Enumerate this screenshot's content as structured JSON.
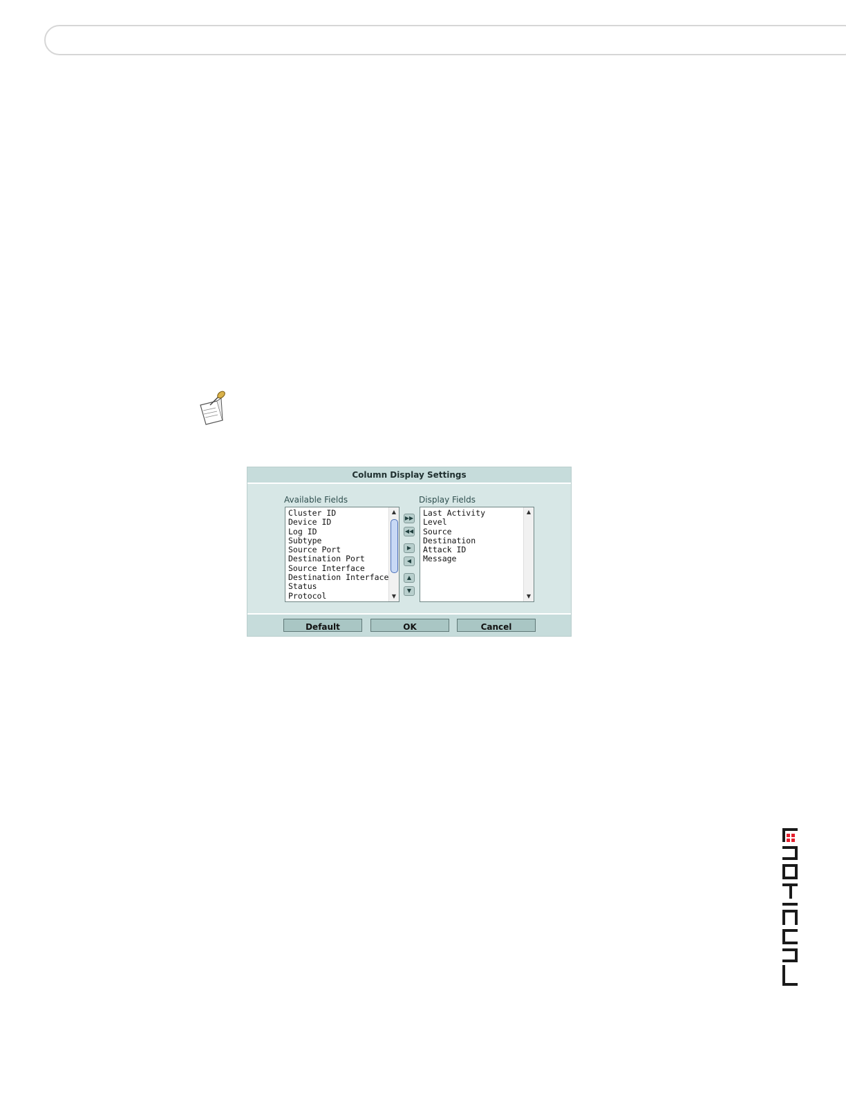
{
  "dialog": {
    "title": "Column Display Settings",
    "available_label": "Available Fields",
    "display_label": "Display Fields",
    "available_fields": [
      "Cluster ID",
      "Device ID",
      "Log ID",
      "Subtype",
      "Source Port",
      "Destination Port",
      "Source Interface",
      "Destination Interface",
      "Status",
      "Protocol"
    ],
    "display_fields": [
      "Last Activity",
      "Level",
      "Source",
      "Destination",
      "Attack ID",
      "Message"
    ],
    "buttons": {
      "default": "Default",
      "ok": "OK",
      "cancel": "Cancel"
    },
    "arrow_icons": [
      "add-all-icon",
      "remove-all-icon",
      "add-icon",
      "remove-icon",
      "move-up-icon",
      "move-down-icon"
    ]
  },
  "logo": {
    "text": "FORTINET",
    "accent_color": "#e4202e"
  },
  "colors": {
    "dialog_bg": "#d7e7e6",
    "title_bg": "#c6dcdb",
    "button_bg": "#a9c6c4"
  }
}
